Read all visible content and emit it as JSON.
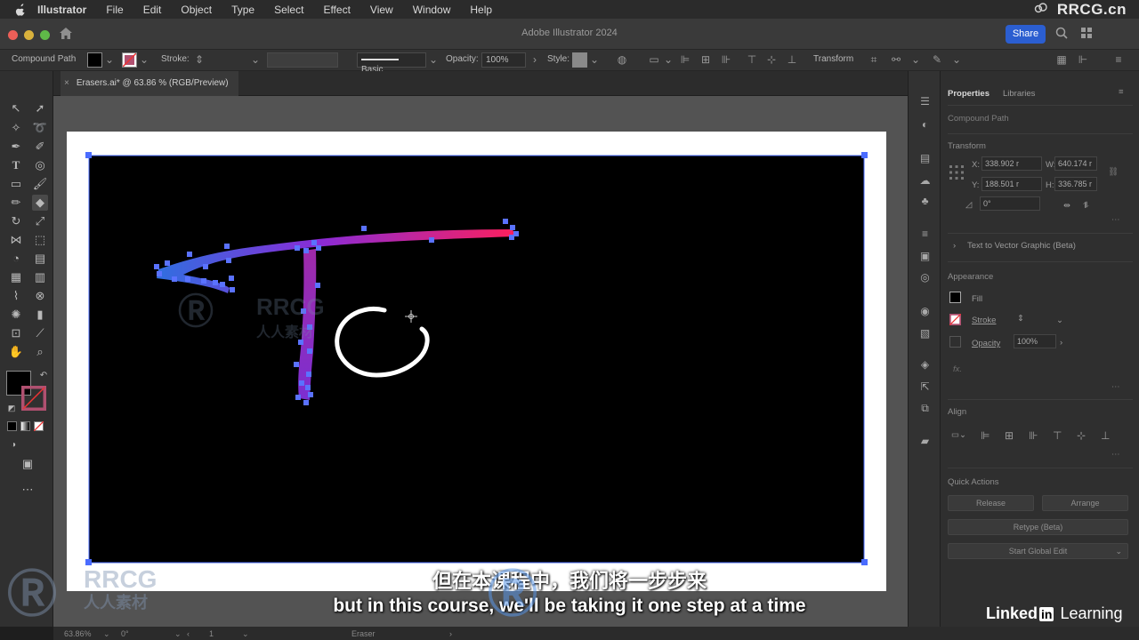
{
  "menubar": {
    "app_name": "Illustrator",
    "items": [
      "File",
      "Edit",
      "Object",
      "Type",
      "Select",
      "Effect",
      "View",
      "Window",
      "Help"
    ],
    "watermark": "RRCG.cn"
  },
  "titlebar": {
    "title": "Adobe Illustrator 2024",
    "share_label": "Share"
  },
  "controlbar": {
    "selection_type": "Compound Path",
    "stroke_label": "Stroke:",
    "brush_label": "Basic",
    "opacity_label": "Opacity:",
    "opacity_value": "100%",
    "style_label": "Style:",
    "transform_label": "Transform"
  },
  "document": {
    "tab_title": "Erasers.ai* @ 63.86 % (RGB/Preview)"
  },
  "properties": {
    "tabs": [
      "Properties",
      "Libraries"
    ],
    "selection": "Compound Path",
    "transform": {
      "heading": "Transform",
      "x_label": "X:",
      "x": "338.902 r",
      "y_label": "Y:",
      "y": "188.501 r",
      "w_label": "W:",
      "w": "640.174 r",
      "h_label": "H:",
      "h": "336.785 r",
      "rotate": "0°"
    },
    "text_to_vector": "Text to Vector Graphic (Beta)",
    "appearance": {
      "heading": "Appearance",
      "fill": "Fill",
      "stroke": "Stroke",
      "opacity_label": "Opacity",
      "opacity": "100%"
    },
    "fx_label": "fx.",
    "align_heading": "Align",
    "quick_actions": {
      "heading": "Quick Actions",
      "release": "Release",
      "arrange": "Arrange",
      "retype": "Retype (Beta)",
      "global_edit": "Start Global Edit"
    }
  },
  "statusbar": {
    "zoom": "63.86%",
    "rotation": "0°",
    "artboard": "1",
    "tool": "Eraser"
  },
  "subtitles": {
    "zh": "但在本课程中，我们将一步步来",
    "en": "but in this course, we'll be taking it one step at a time"
  },
  "branding": {
    "linkedin_a": "Linked",
    "linkedin_in": "in",
    "linkedin_b": " Learning",
    "rrcg": "RRCG",
    "rrcg_cn": "人人素材"
  },
  "colors": {
    "gradient_start": "#2f6fe0",
    "gradient_mid": "#8a2bd6",
    "gradient_end": "#ff1f5a",
    "selection": "#4a6cff",
    "share": "#2b5ed0"
  }
}
